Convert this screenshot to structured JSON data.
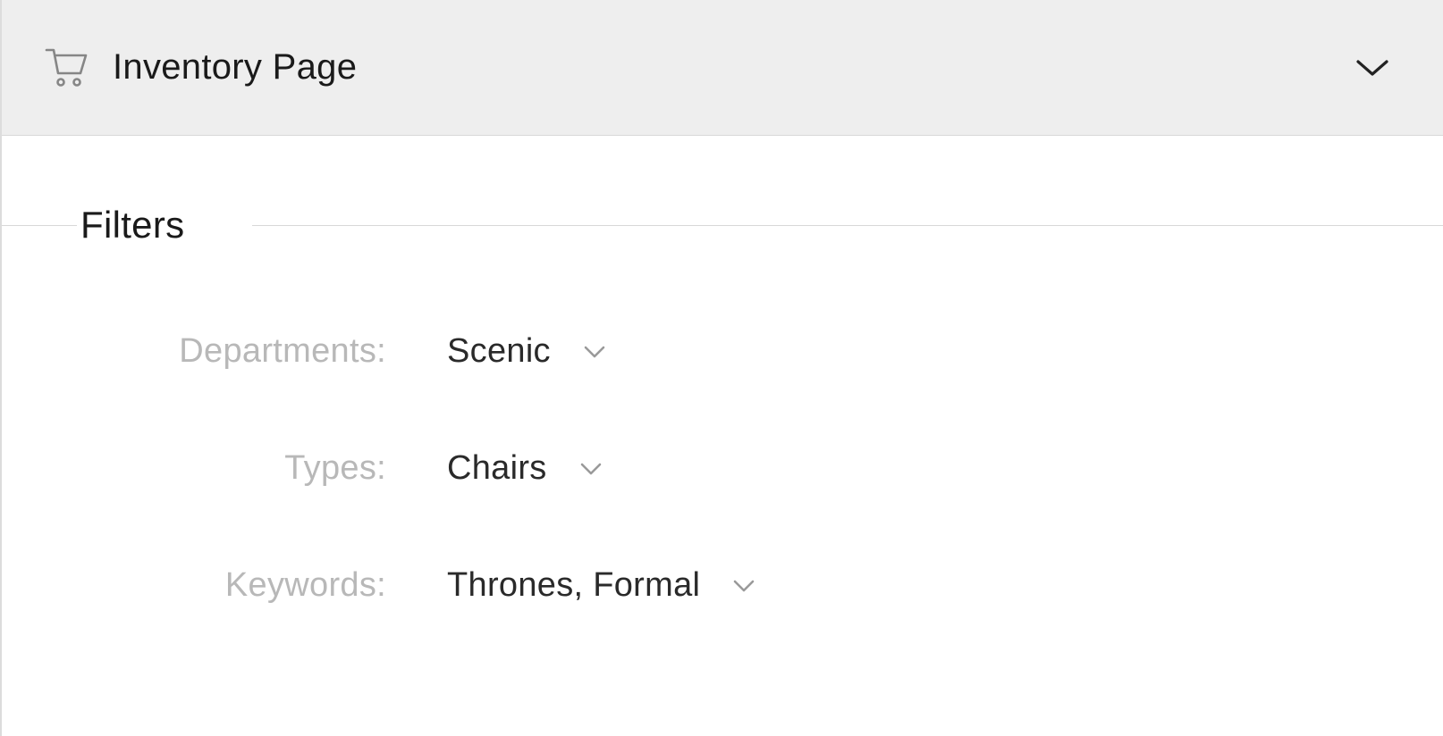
{
  "header": {
    "title": "Inventory Page"
  },
  "filters": {
    "heading": "Filters",
    "rows": [
      {
        "label": "Departments:",
        "value": "Scenic"
      },
      {
        "label": "Types:",
        "value": "Chairs"
      },
      {
        "label": "Keywords:",
        "value": "Thrones, Formal"
      }
    ]
  }
}
